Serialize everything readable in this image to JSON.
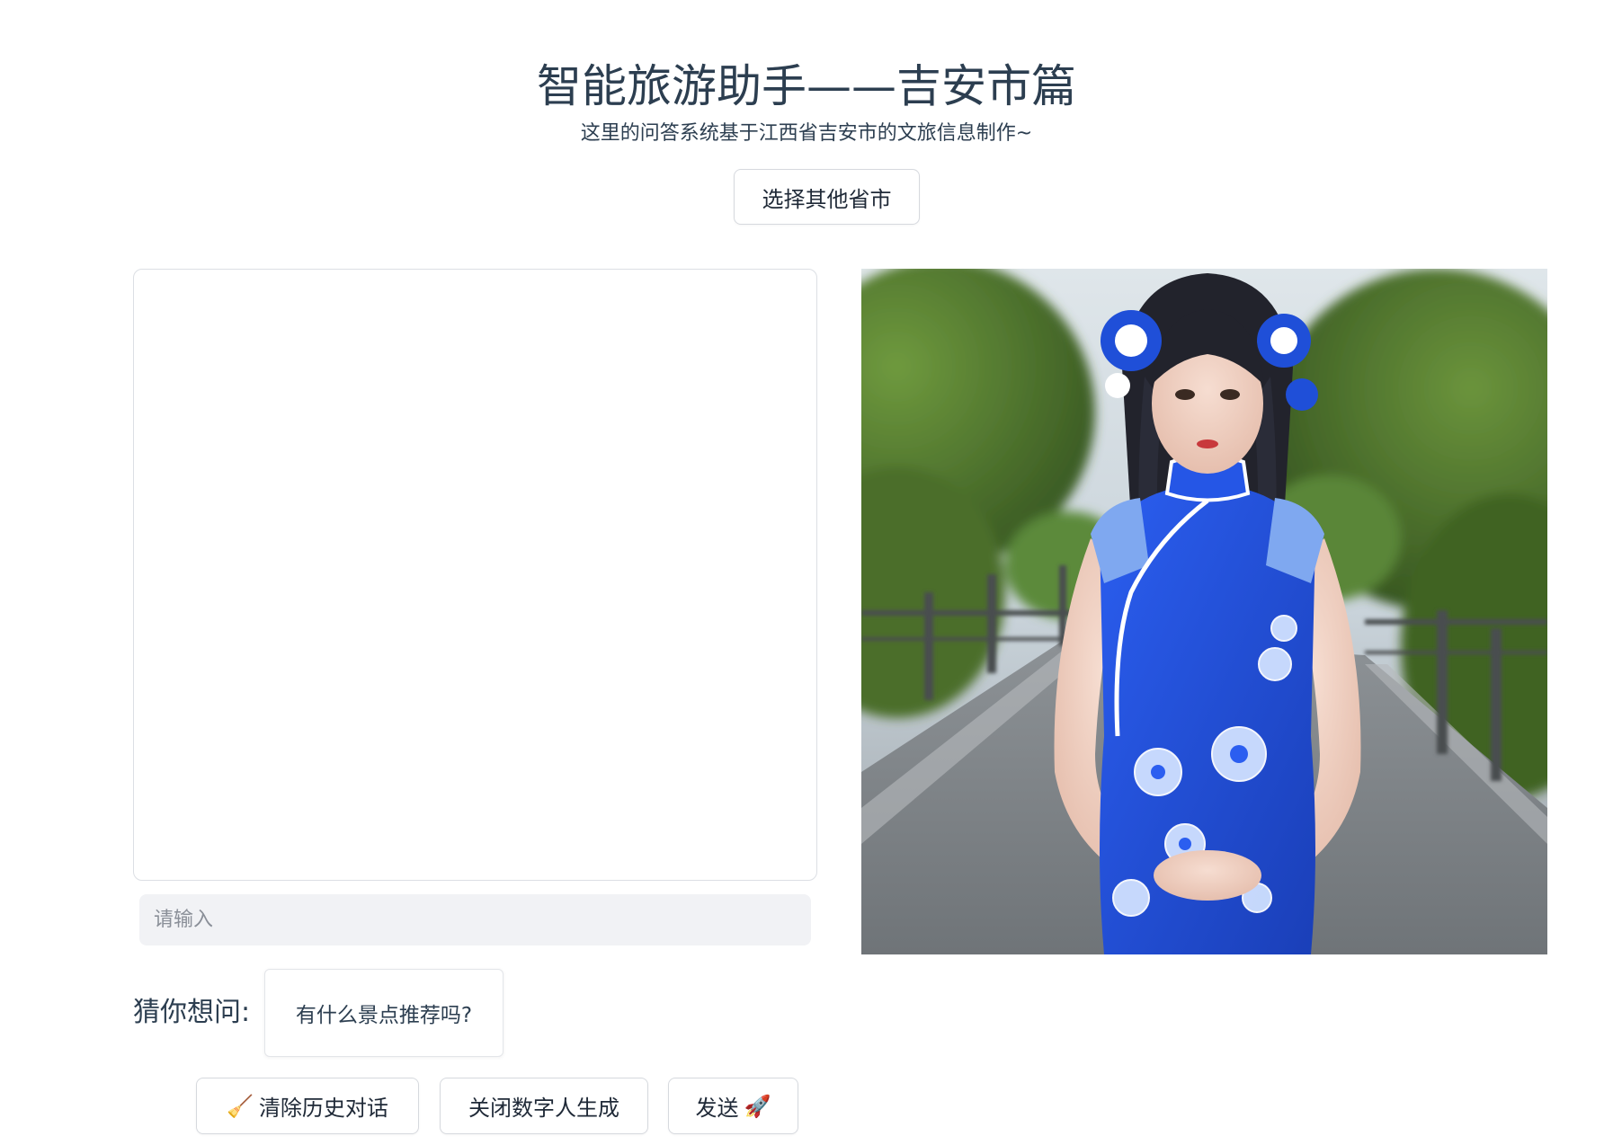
{
  "header": {
    "title": "智能旅游助手——吉安市篇",
    "subtitle": "这里的问答系统基于江西省吉安市的文旅信息制作~",
    "select_button": "选择其他省市"
  },
  "chat": {
    "input_placeholder": "请输入"
  },
  "avatar": {
    "description_icon": "digital-human-portrait"
  },
  "suggestions": {
    "label": "猜你想问:",
    "items": [
      "有什么景点推荐吗?"
    ]
  },
  "actions": {
    "clear_icon": "🧹",
    "clear_label": "清除历史对话",
    "close_label": "关闭数字人生成",
    "send_label": "发送",
    "send_icon": "🚀"
  },
  "colors": {
    "text": "#2c3e50",
    "input_bg": "#f1f2f5",
    "border": "#d6d9de",
    "dress_blue": "#1f4fd8"
  }
}
